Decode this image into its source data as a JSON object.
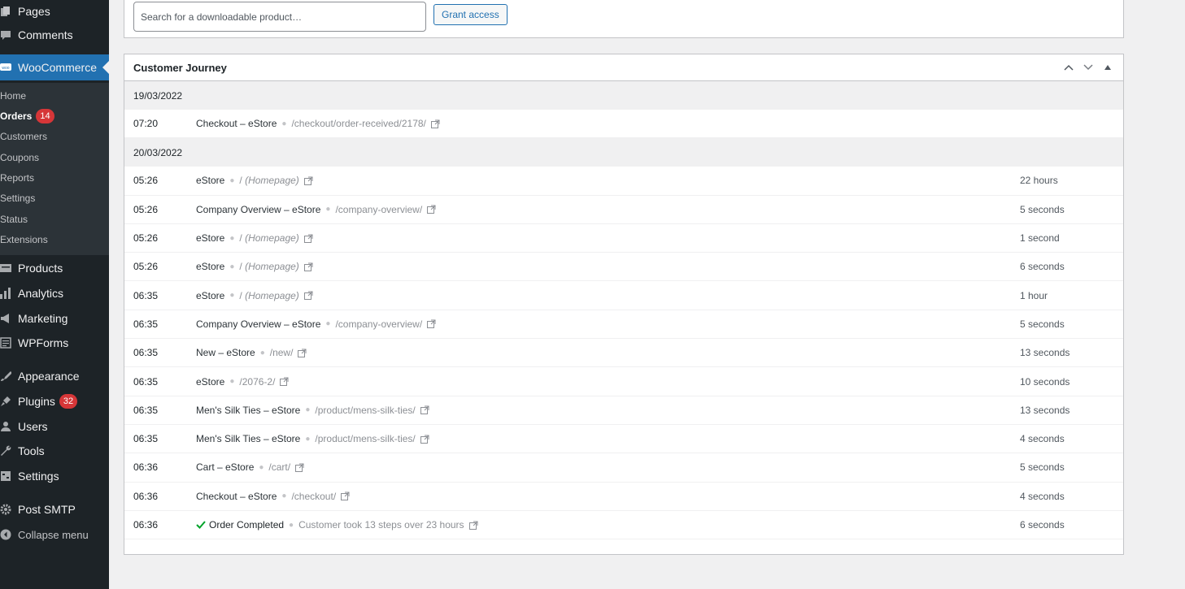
{
  "sidebar": {
    "top_items": [
      {
        "label": "Pages",
        "icon": "pages-icon"
      },
      {
        "label": "Comments",
        "icon": "comments-icon"
      }
    ],
    "woocommerce": {
      "label": "WooCommerce",
      "icon": "woocommerce-icon",
      "icon_text": "woo"
    },
    "submenu": [
      {
        "label": "Home"
      },
      {
        "label": "Orders",
        "badge": "14"
      },
      {
        "label": "Customers"
      },
      {
        "label": "Coupons"
      },
      {
        "label": "Reports"
      },
      {
        "label": "Settings"
      },
      {
        "label": "Status"
      },
      {
        "label": "Extensions"
      }
    ],
    "bottom_items": [
      {
        "label": "Products",
        "icon": "products-icon"
      },
      {
        "label": "Analytics",
        "icon": "analytics-icon"
      },
      {
        "label": "Marketing",
        "icon": "marketing-icon"
      },
      {
        "label": "WPForms",
        "icon": "wpforms-icon"
      },
      {
        "label": "Appearance",
        "icon": "appearance-icon"
      },
      {
        "label": "Plugins",
        "icon": "plugins-icon",
        "badge": "32"
      },
      {
        "label": "Users",
        "icon": "users-icon"
      },
      {
        "label": "Tools",
        "icon": "tools-icon"
      },
      {
        "label": "Settings",
        "icon": "settings-icon"
      },
      {
        "label": "Post SMTP",
        "icon": "post-smtp-icon"
      },
      {
        "label": "Collapse menu",
        "icon": "collapse-menu-icon"
      }
    ]
  },
  "download_panel": {
    "search_placeholder": "Search for a downloadable product…",
    "grant_label": "Grant access"
  },
  "journey": {
    "title": "Customer Journey",
    "days": [
      {
        "date": "19/03/2022",
        "entries": [
          {
            "time": "07:20",
            "title": "Checkout – eStore",
            "path": "/checkout/order-received/2178/",
            "duration": ""
          }
        ]
      },
      {
        "date": "20/03/2022",
        "entries": [
          {
            "time": "05:26",
            "title": "eStore",
            "path": "/",
            "path_note": "(Homepage)",
            "duration": "22 hours"
          },
          {
            "time": "05:26",
            "title": "Company Overview – eStore",
            "path": "/company-overview/",
            "duration": "5 seconds"
          },
          {
            "time": "05:26",
            "title": "eStore",
            "path": "/",
            "path_note": "(Homepage)",
            "duration": "1 second"
          },
          {
            "time": "05:26",
            "title": "eStore",
            "path": "/",
            "path_note": "(Homepage)",
            "duration": "6 seconds"
          },
          {
            "time": "06:35",
            "title": "eStore",
            "path": "/",
            "path_note": "(Homepage)",
            "duration": "1 hour"
          },
          {
            "time": "06:35",
            "title": "Company Overview – eStore",
            "path": "/company-overview/",
            "duration": "5 seconds"
          },
          {
            "time": "06:35",
            "title": "New – eStore",
            "path": "/new/",
            "duration": "13 seconds"
          },
          {
            "time": "06:35",
            "title": "eStore",
            "path": "/2076-2/",
            "duration": "10 seconds"
          },
          {
            "time": "06:35",
            "title": "Men's Silk Ties – eStore",
            "path": "/product/mens-silk-ties/",
            "duration": "13 seconds"
          },
          {
            "time": "06:35",
            "title": "Men's Silk Ties – eStore",
            "path": "/product/mens-silk-ties/",
            "duration": "4 seconds"
          },
          {
            "time": "06:36",
            "title": "Cart – eStore",
            "path": "/cart/",
            "duration": "5 seconds"
          },
          {
            "time": "06:36",
            "title": "Checkout – eStore",
            "path": "/checkout/",
            "duration": "4 seconds"
          },
          {
            "time": "06:36",
            "title": "Order Completed",
            "path": "Customer took 13 steps over 23 hours",
            "completed": true,
            "duration": "6 seconds"
          }
        ]
      }
    ]
  },
  "colors": {
    "sidebar_bg": "#1d2327",
    "submenu_bg": "#2c3338",
    "accent": "#2271b1",
    "badge": "#d63638",
    "success": "#00a32a"
  }
}
